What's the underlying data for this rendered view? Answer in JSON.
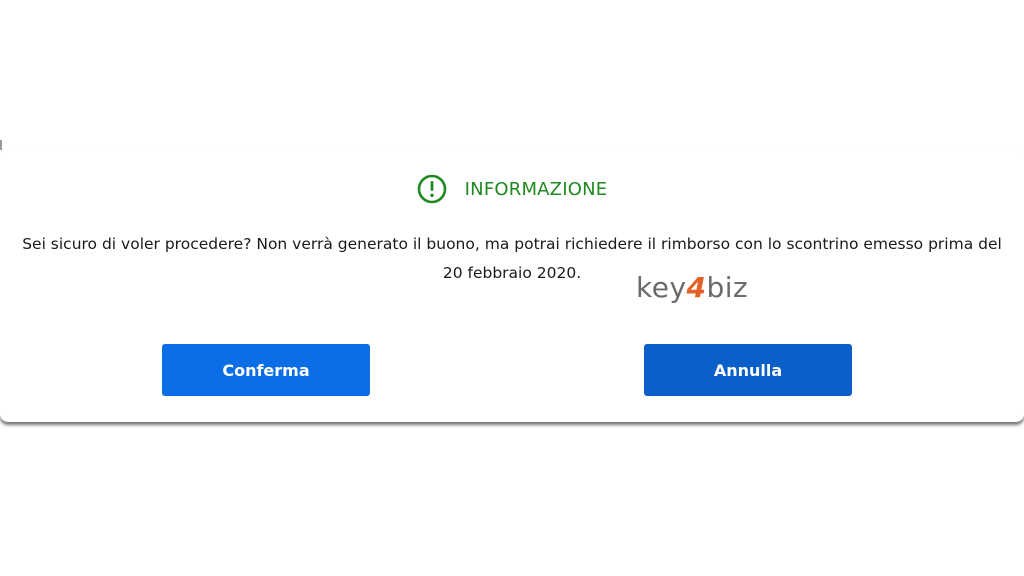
{
  "dialog": {
    "title": "INFORMAZIONE",
    "icon": "info-exclamation-icon",
    "message_line1": "Sei sicuro di voler procedere? Non verrà generato il buono, ma potrai richiedere il rimborso con lo scontrino emesso prima del",
    "message_line2": "20 febbraio 2020.",
    "confirm_label": "Conferma",
    "cancel_label": "Annulla"
  },
  "watermark": {
    "part1": "key",
    "part2": "4",
    "part3": "biz"
  },
  "colors": {
    "title_green": "#1f8a1f",
    "primary_blue": "#0b6ee6",
    "secondary_blue": "#0a5fc9",
    "watermark_gray": "#6b6b6b",
    "watermark_orange": "#e2622a"
  }
}
